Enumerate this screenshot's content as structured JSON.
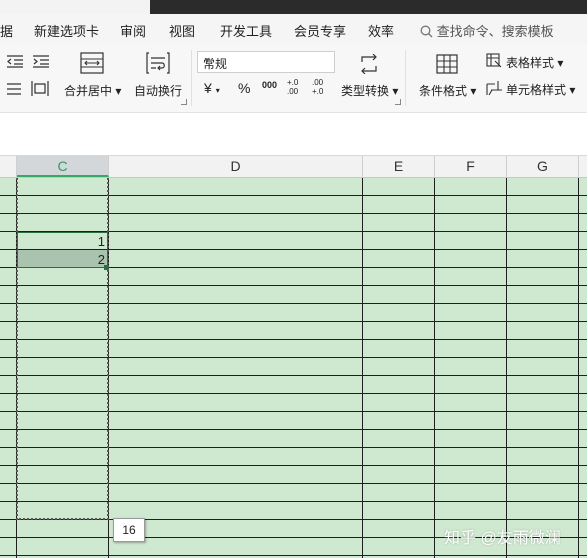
{
  "menu": {
    "items": [
      "据",
      "新建选项卡",
      "审阅",
      "视图",
      "开发工具",
      "会员专享",
      "效率"
    ],
    "search_placeholder": "查找命令、搜索模板"
  },
  "ribbon": {
    "merge_label": "合并居中",
    "wrap_label": "自动换行",
    "number_format": "常规",
    "currency_symbol": "¥",
    "percent_symbol": "%",
    "thousands_symbol": "000",
    "dec_inc_symbol": "+.0 .00",
    "dec_dec_symbol": ".00 +.0",
    "type_convert_label": "类型转换",
    "cond_format_label": "条件格式",
    "table_style_label": "表格样式",
    "cell_style_label": "单元格样式"
  },
  "columns": [
    "C",
    "D",
    "E",
    "F",
    "G"
  ],
  "cells": {
    "c1": "1",
    "c2": "2"
  },
  "fill_tooltip": "16",
  "watermark": "知乎 @友雨微澜",
  "colors": {
    "grid_fill": "#cfe8d0",
    "selected_col_text": "#2e9e5e",
    "selection_fill": "#a9c3ae"
  }
}
